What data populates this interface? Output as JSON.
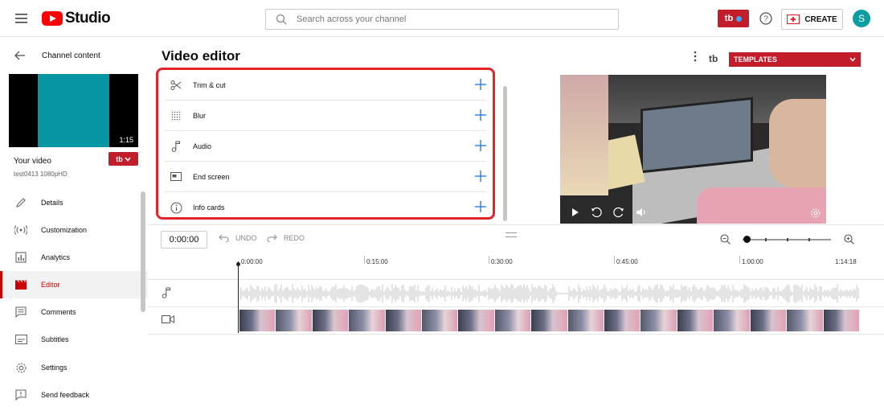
{
  "header": {
    "logo_text": "Studio",
    "search_placeholder": "Search across your channel",
    "tb_badge": "tb",
    "create_label": "CREATE",
    "avatar_initial": "S"
  },
  "sidebar": {
    "back_label": "Channel content",
    "thumbnail_duration": "1:15",
    "video_title": "Your video",
    "video_subtitle": "test0413 1080pHD",
    "tb_small": "tb",
    "nav": [
      {
        "label": "Details",
        "icon": "pencil-icon"
      },
      {
        "label": "Customization",
        "icon": "broadcast-icon"
      },
      {
        "label": "Analytics",
        "icon": "bar-chart-icon"
      },
      {
        "label": "Editor",
        "icon": "clapperboard-icon",
        "active": true
      },
      {
        "label": "Comments",
        "icon": "comment-icon"
      },
      {
        "label": "Subtitles",
        "icon": "subtitles-icon"
      }
    ],
    "bottom": [
      {
        "label": "Settings",
        "icon": "gear-icon"
      },
      {
        "label": "Send feedback",
        "icon": "feedback-icon"
      }
    ]
  },
  "editor": {
    "title": "Video editor",
    "templates_label": "TEMPLATES",
    "tb_logo": "tb",
    "tools": [
      {
        "label": "Trim & cut",
        "icon": "scissors-icon"
      },
      {
        "label": "Blur",
        "icon": "blur-grid-icon"
      },
      {
        "label": "Audio",
        "icon": "music-note-icon"
      },
      {
        "label": "End screen",
        "icon": "end-screen-icon"
      },
      {
        "label": "Info cards",
        "icon": "info-icon"
      }
    ],
    "timecode": "0:00:00",
    "undo_label": "UNDO",
    "redo_label": "REDO",
    "ruler": [
      "0:00:00",
      "0:15:00",
      "0:30:00",
      "0:45:00",
      "1:00:00",
      "1:14:18"
    ]
  },
  "colors": {
    "brand_red": "#c21d2b",
    "highlight_red": "#e3242b",
    "accent_blue": "#3ea6ff",
    "avatar_teal": "#0a9ea3"
  }
}
